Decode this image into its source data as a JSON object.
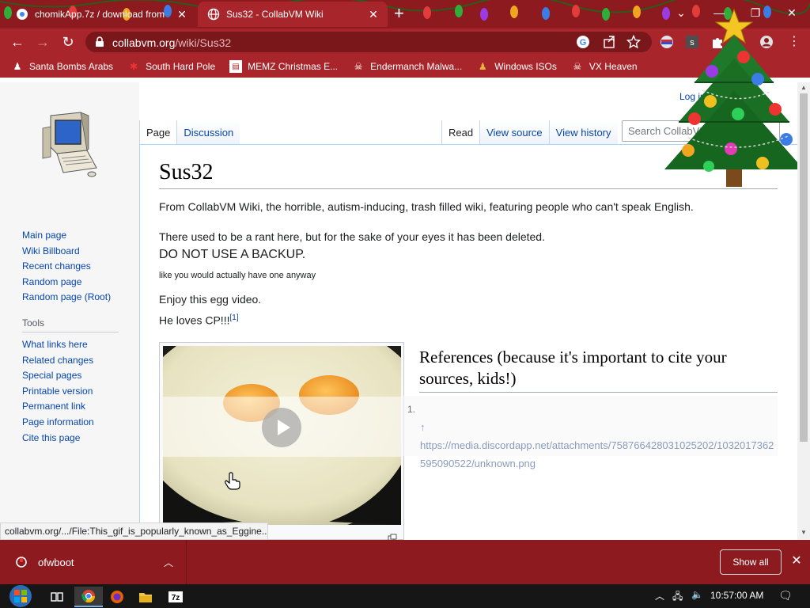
{
  "browser": {
    "tabs": [
      {
        "title": "chomikApp.7z / download from",
        "close": "✕"
      },
      {
        "title": "Sus32 - CollabVM Wiki",
        "close": "✕"
      }
    ],
    "new_tab": "+",
    "window_controls": {
      "dropdown": "⌄",
      "minimize": "—",
      "maximize": "❐",
      "close": "✕"
    },
    "url_host": "collabvm.org",
    "url_path": "/wiki/Sus32",
    "bookmarks": [
      {
        "label": "Santa Bombs Arabs",
        "icon": "person-icon"
      },
      {
        "label": "South Hard Pole",
        "icon": "snowflake-icon"
      },
      {
        "label": "MEMZ Christmas E...",
        "icon": "page-icon"
      },
      {
        "label": "Endermanch Malwa...",
        "icon": "skull-icon"
      },
      {
        "label": "Windows ISOs",
        "icon": "person-icon"
      },
      {
        "label": "VX Heaven",
        "icon": "skull-icon"
      }
    ],
    "status_url": "collabvm.org/.../File:This_gif_is_popularly_known_as_Eggine..."
  },
  "wiki": {
    "login": "Log in",
    "tabs_left": [
      "Page",
      "Discussion"
    ],
    "tabs_right": [
      "Read",
      "View source",
      "View history"
    ],
    "search_placeholder": "Search CollabVM",
    "nav": [
      "Main page",
      "Wiki Billboard",
      "Recent changes",
      "Random page",
      "Random page (Root)"
    ],
    "tools_heading": "Tools",
    "tools": [
      "What links here",
      "Related changes",
      "Special pages",
      "Printable version",
      "Permanent link",
      "Page information",
      "Cite this page"
    ],
    "title": "Sus32",
    "tagline": "From CollabVM Wiki, the horrible, autism-inducing, trash filled wiki, featuring people who can't speak English.",
    "p1": "There used to be a rant here, but for the sake of your eyes it has been deleted.",
    "p2": "DO NOT USE A BACKUP.",
    "p3": "like you would actually have one anyway",
    "p4": "Enjoy this egg video.",
    "p5": "He loves CP!!!",
    "p5_ref": "[1]",
    "references_heading": "References (because it's important to cite your sources, kids!)",
    "ref_number": "1.",
    "ref_arrow": "↑",
    "ref_url": "https://media.discordapp.net/attachments/758766428031025202/1032017362595090522/unknown.png"
  },
  "downloads": {
    "file": "ofwboot",
    "show_all": "Show all",
    "close": "✕"
  },
  "taskbar": {
    "time": "10:57:00 AM"
  },
  "colors": {
    "chrome_dark": "#8c1a1f",
    "chrome": "#a8262b",
    "link": "#0645ad"
  }
}
